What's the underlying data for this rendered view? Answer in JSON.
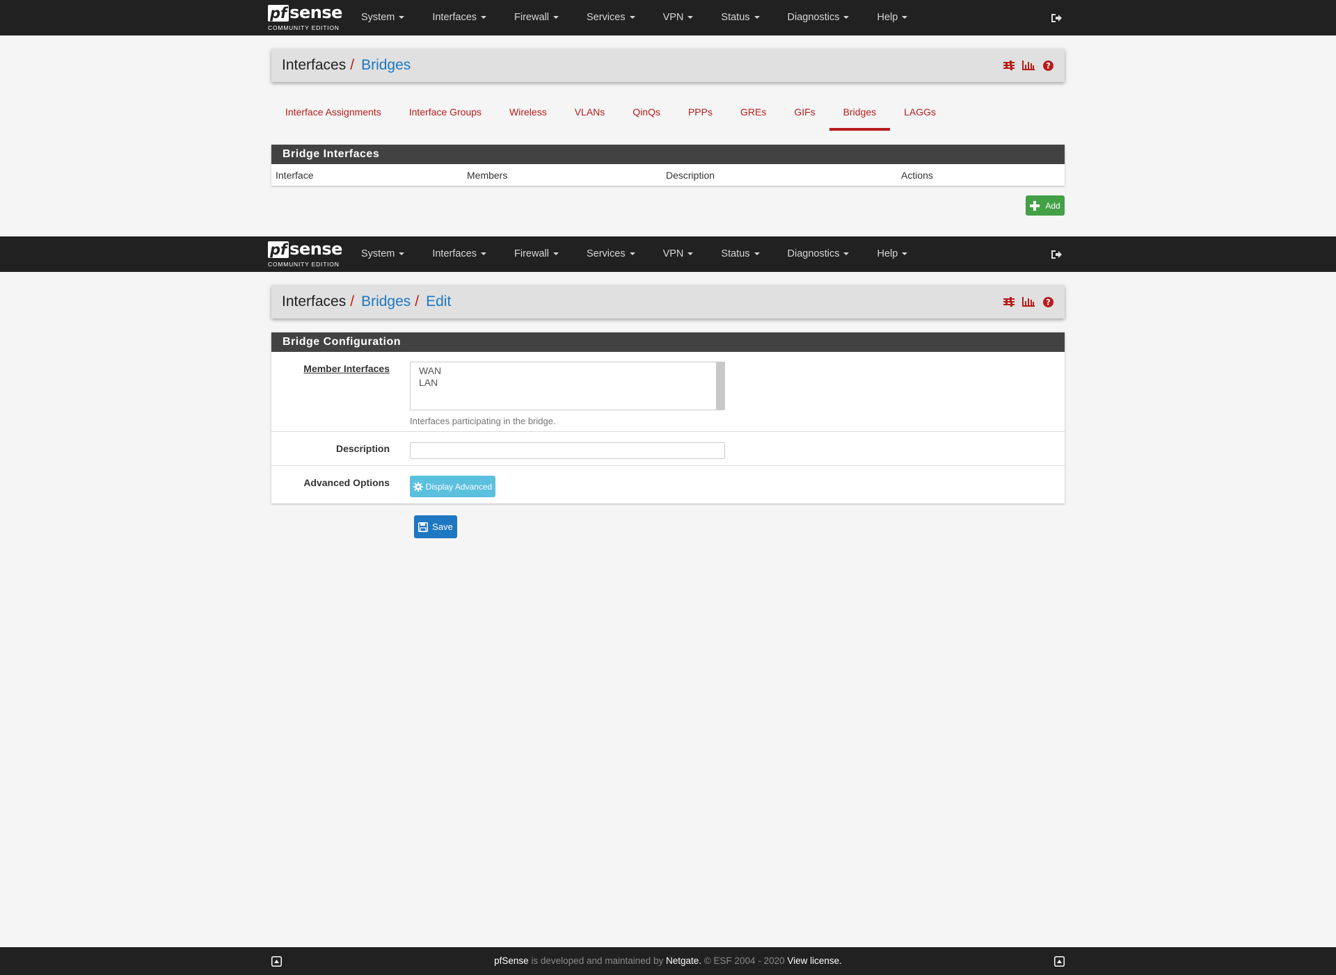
{
  "brand": {
    "pf": "pf",
    "sense": "sense",
    "sub": "COMMUNITY EDITION"
  },
  "nav": {
    "items": [
      "System",
      "Interfaces",
      "Firewall",
      "Services",
      "VPN",
      "Status",
      "Diagnostics",
      "Help"
    ]
  },
  "page1": {
    "breadcrumb": {
      "root": "Interfaces",
      "current": "Bridges"
    },
    "tabs": [
      "Interface Assignments",
      "Interface Groups",
      "Wireless",
      "VLANs",
      "QinQs",
      "PPPs",
      "GREs",
      "GIFs",
      "Bridges",
      "LAGGs"
    ],
    "active_tab": "Bridges",
    "panel_title": "Bridge Interfaces",
    "columns": [
      "Interface",
      "Members",
      "Description",
      "Actions"
    ],
    "add_label": "Add"
  },
  "page2": {
    "breadcrumb": {
      "root": "Interfaces",
      "middle": "Bridges",
      "current": "Edit"
    },
    "panel_title": "Bridge Configuration",
    "member_label": "Member Interfaces",
    "member_options": [
      "WAN",
      "LAN"
    ],
    "member_help": "Interfaces participating in the bridge.",
    "description_label": "Description",
    "description_value": "",
    "advanced_label": "Advanced Options",
    "advanced_button": "Display Advanced",
    "save_label": "Save"
  },
  "footer": {
    "brand": "pfSense",
    "text1": " is developed and maintained by ",
    "company": "Netgate.",
    "text2": " © ESF 2004 - 2020 ",
    "license": "View license."
  },
  "colors": {
    "navbar": "#212121",
    "accent_red": "#b71c1c",
    "link_blue": "#1e77c0",
    "add_green": "#43a047",
    "info": "#5bc0de"
  }
}
